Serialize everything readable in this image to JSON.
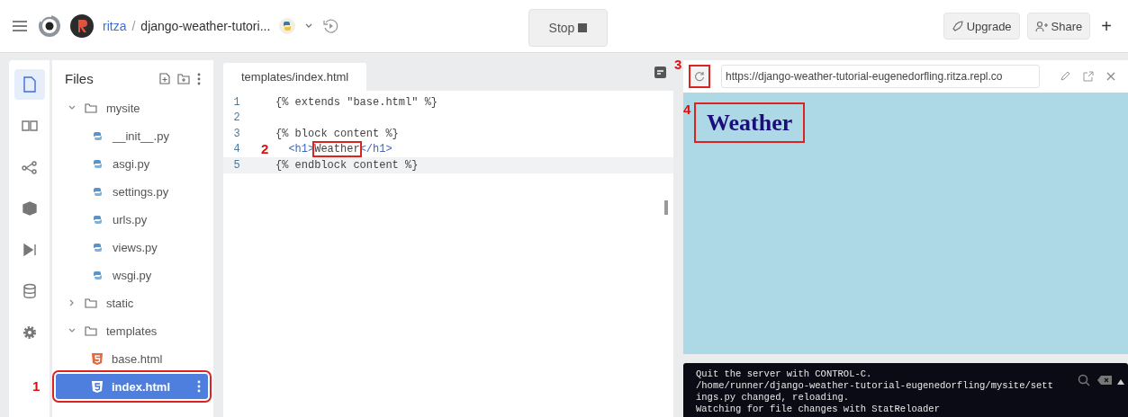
{
  "topbar": {
    "owner": "ritza",
    "separator": "/",
    "repl_name": "django-weather-tutori...",
    "run_button": "Stop",
    "buttons": [
      {
        "label": "Upgrade",
        "kind": "upgrade"
      },
      {
        "label": "Share",
        "kind": "share"
      }
    ],
    "add_button": "+"
  },
  "rail": [
    {
      "kind": "files",
      "selected": true
    },
    {
      "kind": "docs",
      "selected": false
    },
    {
      "kind": "git",
      "selected": false
    },
    {
      "kind": "packages",
      "selected": false
    },
    {
      "kind": "debugger",
      "selected": false
    },
    {
      "kind": "database",
      "selected": false
    },
    {
      "kind": "settings",
      "selected": false
    }
  ],
  "files": {
    "title": "Files",
    "tree": [
      {
        "name": "mysite",
        "kind": "folder",
        "expanded": true,
        "selected": false,
        "children": [
          {
            "name": "__init__.py",
            "kind": "python",
            "selected": false
          },
          {
            "name": "asgi.py",
            "kind": "python",
            "selected": false
          },
          {
            "name": "settings.py",
            "kind": "python",
            "selected": false
          },
          {
            "name": "urls.py",
            "kind": "python",
            "selected": false
          },
          {
            "name": "views.py",
            "kind": "python",
            "selected": false
          },
          {
            "name": "wsgi.py",
            "kind": "python",
            "selected": false
          }
        ]
      },
      {
        "name": "static",
        "kind": "folder",
        "expanded": false,
        "selected": false
      },
      {
        "name": "templates",
        "kind": "folder",
        "expanded": true,
        "selected": false,
        "children": [
          {
            "name": "base.html",
            "kind": "html",
            "selected": false
          },
          {
            "name": "index.html",
            "kind": "html",
            "selected": true,
            "annotation": "1"
          }
        ]
      }
    ]
  },
  "editor": {
    "tab": "templates/index.html",
    "lines": [
      {
        "number": "1",
        "current": false,
        "tokens": [
          {
            "text": "{% extends \"base.html\" %}",
            "kind": "template"
          }
        ]
      },
      {
        "number": "2",
        "current": false
      },
      {
        "number": "3",
        "current": false,
        "tokens": [
          {
            "text": "{% block content %}",
            "kind": "template"
          }
        ]
      },
      {
        "number": "4",
        "current": false,
        "annotation": "2",
        "tokens": [
          {
            "text": "  <h1>",
            "kind": "tag"
          },
          {
            "text": "Weather",
            "kind": "text",
            "annotation": true
          },
          {
            "text": "</h1>",
            "kind": "tag"
          }
        ]
      },
      {
        "number": "5",
        "current": true,
        "tokens": [
          {
            "text": "{% endblock content %}",
            "kind": "template"
          }
        ]
      }
    ]
  },
  "preview": {
    "reload_annotation": "3",
    "url": "https://django-weather-tutorial-eugenedorfling.ritza.repl.co",
    "heading": "Weather",
    "heading_annotation": "4"
  },
  "console": {
    "lines": [
      "Quit the server with CONTROL-C.",
      "/home/runner/django-weather-tutorial-eugenedorfling/mysite/sett",
      "ings.py changed, reloading.",
      "Watching for file changes with StatReloader"
    ]
  }
}
